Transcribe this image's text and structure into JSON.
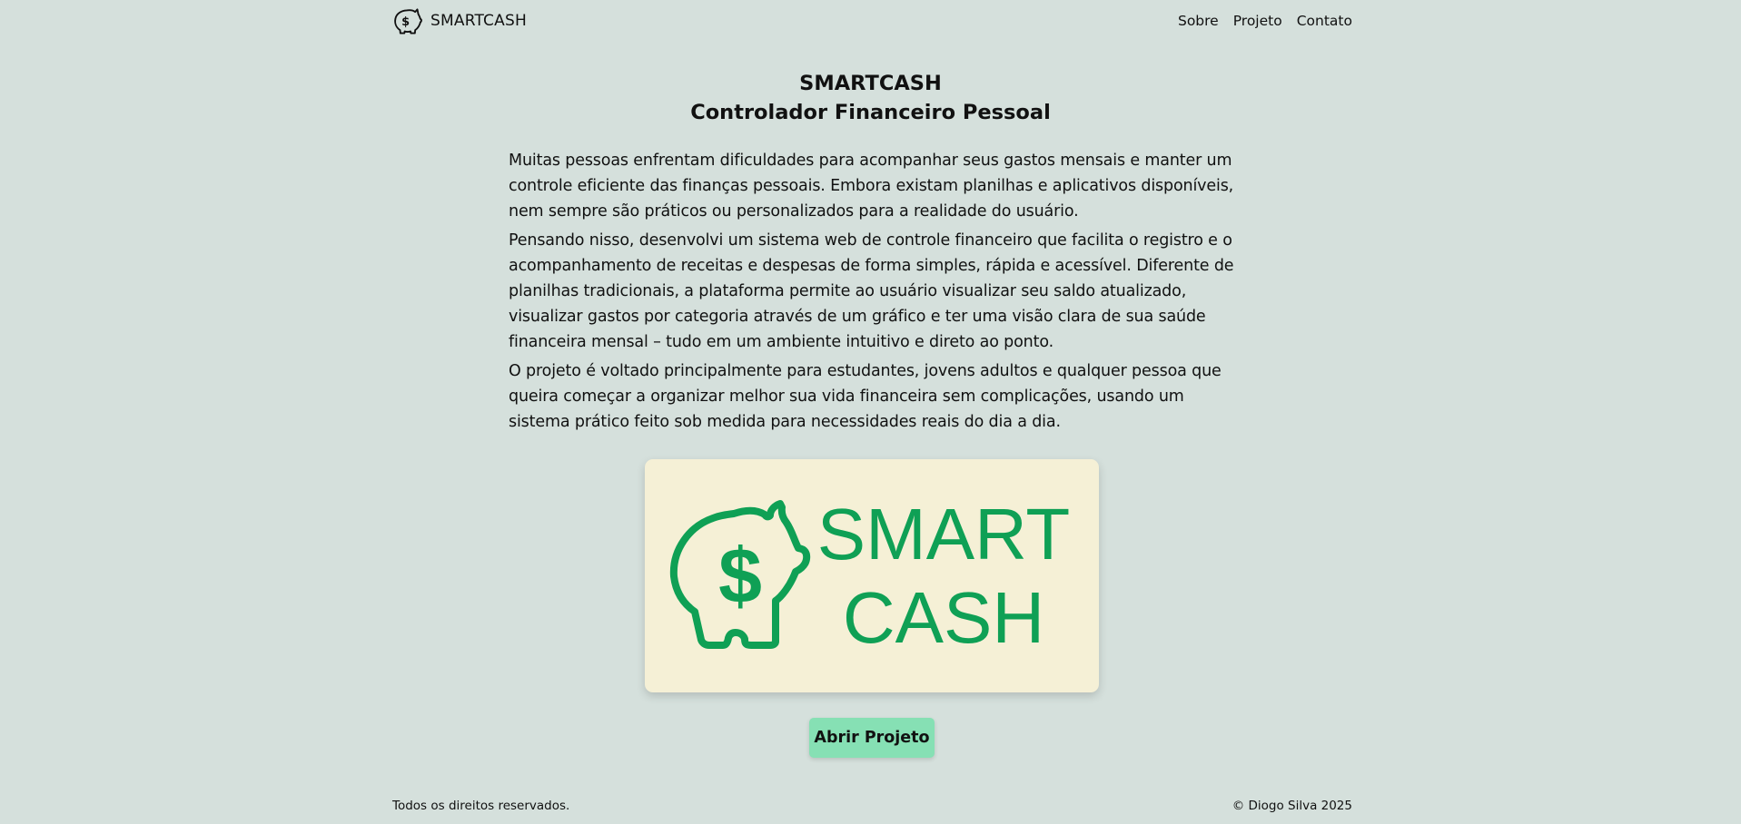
{
  "header": {
    "brand": "SMARTCASH",
    "nav": [
      "Sobre",
      "Projeto",
      "Contato"
    ]
  },
  "hero": {
    "title": "SMARTCASH",
    "subtitle": "Controlador Financeiro Pessoal"
  },
  "content": {
    "paragraphs": [
      "Muitas pessoas enfrentam dificuldades para acompanhar seus gastos mensais e manter um controle eficiente das finanças pessoais. Embora existam planilhas e aplicativos disponíveis, nem sempre são práticos ou personalizados para a realidade do usuário.",
      "Pensando nisso, desenvolvi um sistema web de controle financeiro que facilita o registro e o acompanhamento de receitas e despesas de forma simples, rápida e acessível. Diferente de planilhas tradicionais, a plataforma permite ao usuário visualizar seu saldo atualizado, visualizar gastos por categoria através de um gráfico e ter uma visão clara de sua saúde financeira mensal – tudo em um ambiente intuitivo e direto ao ponto.",
      "O projeto é voltado principalmente para estudantes, jovens adultos e qualquer pessoa que queira começar a organizar melhor sua vida financeira sem complicações, usando um sistema prático feito sob medida para necessidades reais do dia a dia."
    ]
  },
  "logo": {
    "line1": "SMART",
    "line2": "CASH",
    "color": "#0fa055",
    "background": "#f5f0d6"
  },
  "cta": {
    "label": "Abrir Projeto",
    "color": "#86e0b4"
  },
  "footer": {
    "left": "Todos os direitos reservados.",
    "right": "© Diogo Silva 2025"
  },
  "icons": {
    "brand": "piggy-bank-dollar-icon"
  }
}
